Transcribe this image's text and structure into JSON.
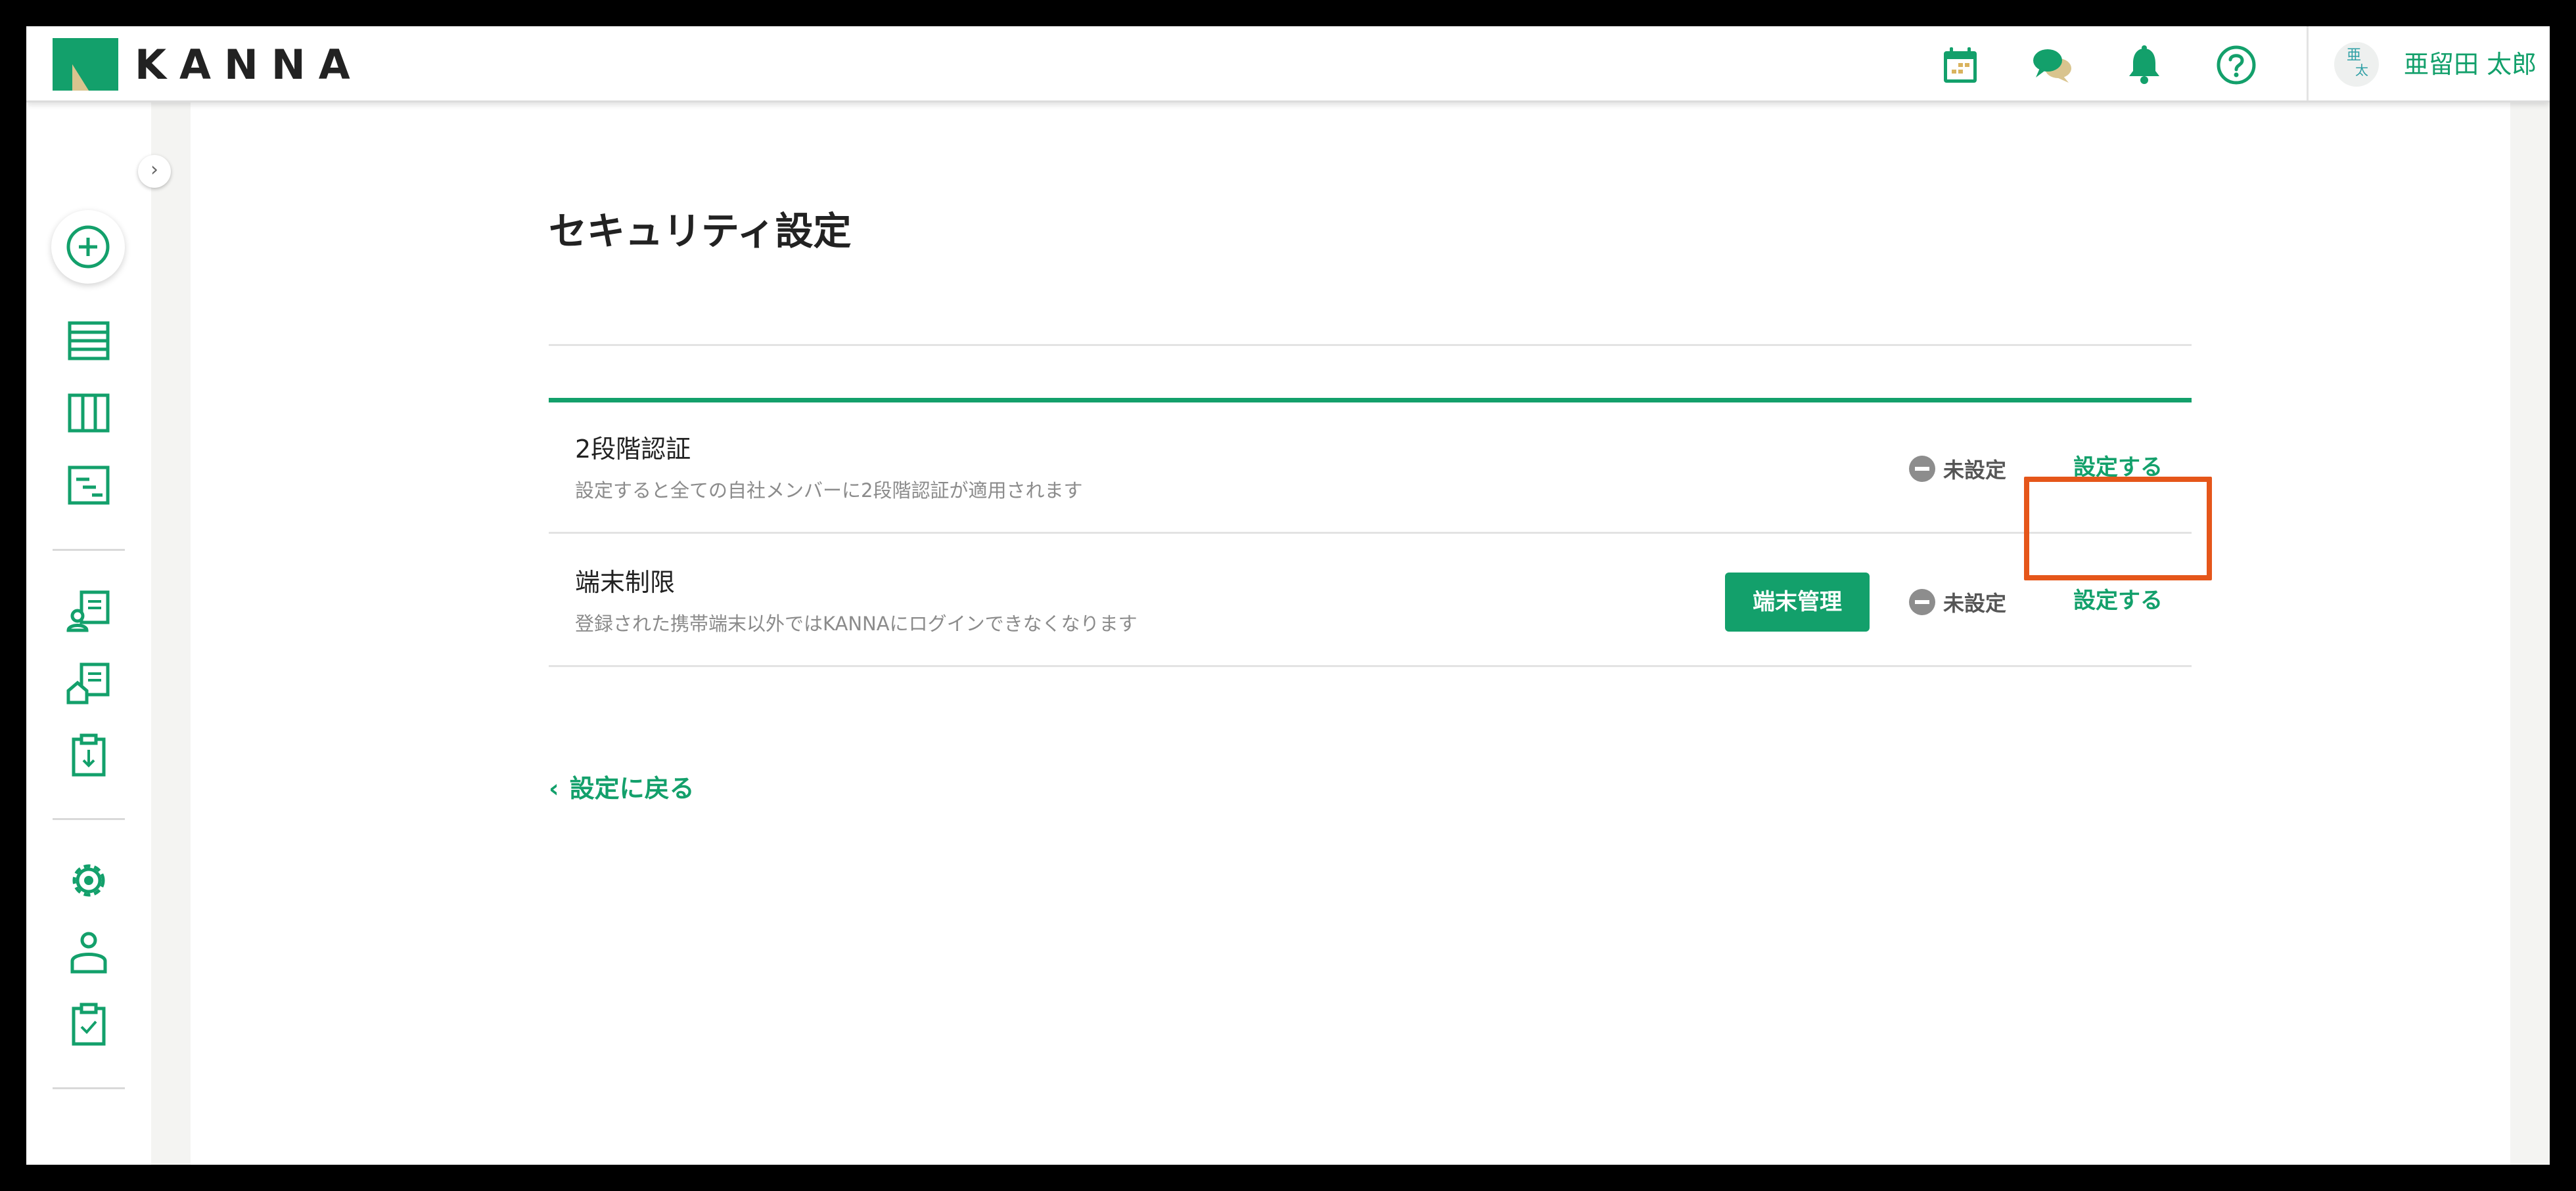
{
  "header": {
    "logo_text": "KANNA",
    "user": {
      "avatar_line1": "亜",
      "avatar_line2": "太",
      "name": "亜留田 太郎"
    },
    "icons": [
      "calendar-icon",
      "chat-icon",
      "bell-icon",
      "help-icon"
    ]
  },
  "sidebar": {
    "collapse_glyph": "›",
    "items": [
      "add-icon",
      "list-icon",
      "board-icon",
      "gantt-icon",
      "project-user-icon",
      "building-icon",
      "download-doc-icon",
      "settings-icon",
      "member-icon",
      "checklist-icon"
    ]
  },
  "page": {
    "title": "セキュリティ設定",
    "rows": [
      {
        "title": "2段階認証",
        "description": "設定すると全ての自社メンバーに2段階認証が適用されます",
        "status": "未設定",
        "action": "設定する"
      },
      {
        "title": "端末制限",
        "description": "登録された携帯端末以外ではKANNAにログインできなくなります",
        "manage_button": "端末管理",
        "status": "未設定",
        "action": "設定する"
      }
    ],
    "back_link": "設定に戻る",
    "back_glyph": "‹"
  },
  "colors": {
    "accent": "#13a06b",
    "highlight": "#e5561a",
    "status_gray": "#8d8d8d"
  }
}
